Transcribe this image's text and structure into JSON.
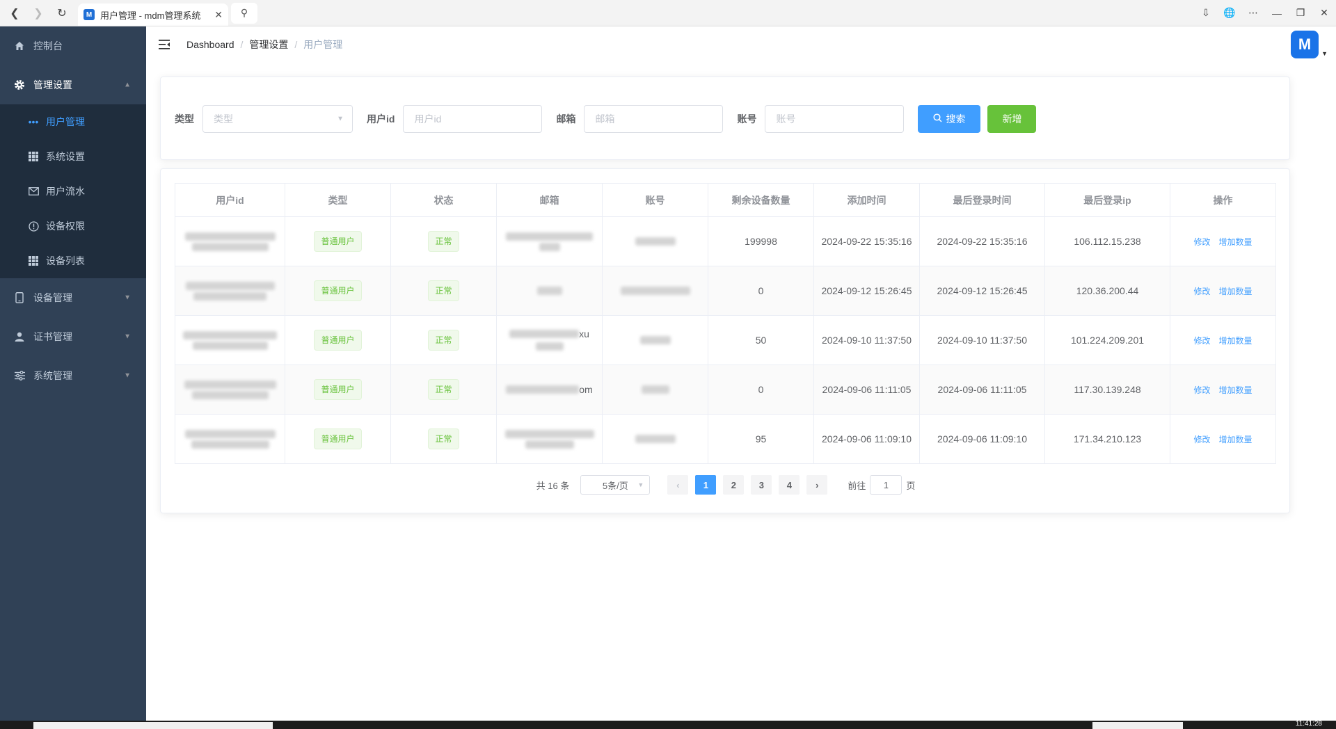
{
  "browser": {
    "tab_title": "用户管理 - mdm管理系统",
    "favicon_text": "M",
    "clock": "11:41:28"
  },
  "sidebar": {
    "items": [
      {
        "label": "控制台",
        "icon": "home-icon"
      },
      {
        "label": "管理设置",
        "icon": "gear-icon",
        "expanded": true
      },
      {
        "label": "设备管理",
        "icon": "phone-icon"
      },
      {
        "label": "证书管理",
        "icon": "user-icon"
      },
      {
        "label": "系统管理",
        "icon": "sliders-icon"
      }
    ],
    "sub_items": [
      {
        "label": "用户管理",
        "icon": "dots-icon",
        "active": true
      },
      {
        "label": "系统设置",
        "icon": "grid-icon"
      },
      {
        "label": "用户流水",
        "icon": "mail-icon"
      },
      {
        "label": "设备权限",
        "icon": "info-circle-icon"
      },
      {
        "label": "设备列表",
        "icon": "grid-icon"
      }
    ]
  },
  "breadcrumb": [
    "Dashboard",
    "管理设置",
    "用户管理"
  ],
  "avatar_text": "M",
  "search_form": {
    "type_label": "类型",
    "type_placeholder": "类型",
    "userid_label": "用户id",
    "userid_placeholder": "用户id",
    "email_label": "邮箱",
    "email_placeholder": "邮箱",
    "account_label": "账号",
    "account_placeholder": "账号",
    "search_button": "搜索",
    "add_button": "新增"
  },
  "table": {
    "headers": [
      "用户id",
      "类型",
      "状态",
      "邮箱",
      "账号",
      "剩余设备数量",
      "添加时间",
      "最后登录时间",
      "最后登录ip",
      "操作"
    ],
    "rows": [
      {
        "type": "普通用户",
        "status": "正常",
        "email_suffix": "",
        "remaining": "199998",
        "added": "2024-09-22 15:35:16",
        "last_login": "2024-09-22 15:35:16",
        "ip": "106.112.15.238"
      },
      {
        "type": "普通用户",
        "status": "正常",
        "email_suffix": "",
        "remaining": "0",
        "added": "2024-09-12 15:26:45",
        "last_login": "2024-09-12 15:26:45",
        "ip": "120.36.200.44"
      },
      {
        "type": "普通用户",
        "status": "正常",
        "email_suffix": "xu",
        "remaining": "50",
        "added": "2024-09-10 11:37:50",
        "last_login": "2024-09-10 11:37:50",
        "ip": "101.224.209.201"
      },
      {
        "type": "普通用户",
        "status": "正常",
        "email_suffix": "om",
        "remaining": "0",
        "added": "2024-09-06 11:11:05",
        "last_login": "2024-09-06 11:11:05",
        "ip": "117.30.139.248"
      },
      {
        "type": "普通用户",
        "status": "正常",
        "email_suffix": "",
        "remaining": "95",
        "added": "2024-09-06 11:09:10",
        "last_login": "2024-09-06 11:09:10",
        "ip": "171.34.210.123"
      }
    ],
    "edit_label": "修改",
    "add_count_label": "增加数量"
  },
  "pagination": {
    "total_text": "共 16 条",
    "page_size": "5条/页",
    "pages": [
      "1",
      "2",
      "3",
      "4"
    ],
    "current": "1",
    "goto_label": "前往",
    "goto_value": "1",
    "page_suffix": "页"
  },
  "colors": {
    "sidebar_bg": "#304156",
    "submenu_bg": "#1f2d3d",
    "primary": "#409eff",
    "success": "#67c23a"
  }
}
